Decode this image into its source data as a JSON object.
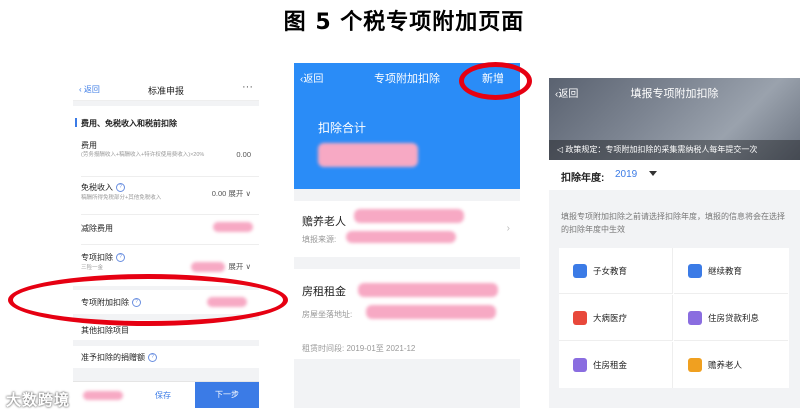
{
  "figure_title": "图 5  个税专项附加页面",
  "panel1": {
    "back": "返回",
    "title": "标准申报",
    "more": "···",
    "section": "费用、免税收入和税前扣除",
    "fee_label": "费用",
    "fee_desc": "(劳务报酬收入+稿酬收入+特许权使用费收入)×20%",
    "fee_value": "0.00",
    "exempt_label": "免税收入",
    "exempt_desc": "稿酬所得免税部分+其他免税收入",
    "exempt_value": "0.00",
    "expand": "展开",
    "deduct_fee_label": "减除费用",
    "special_label": "专项扣除",
    "special_sub": "三险一金",
    "special_add_label": "专项附加扣除",
    "other_label": "其他扣除项目",
    "donation_label": "准予扣除的捐赠额",
    "save": "保存",
    "next": "下一步"
  },
  "panel2": {
    "back": "返回",
    "title": "专项附加扣除",
    "add": "新增",
    "total": "扣除合计",
    "items": [
      {
        "name": "赡养老人",
        "meta": "填报来源:"
      },
      {
        "name": "房租租金",
        "meta": "房屋坐落地址:",
        "meta2": "租赁时间段: 2019-01至 2021-12"
      }
    ]
  },
  "panel3": {
    "back": "返回",
    "title": "填报专项附加扣除",
    "notice": "政策规定：专项附加扣除的采集需纳税人每年提交一次",
    "year_label": "扣除年度:",
    "year_value": "2019",
    "tip": "填报专项附加扣除之前请选择扣除年度，填报的信息将会在选择的扣除年度中生效",
    "categories": [
      {
        "label": "子女教育",
        "icon": "books-icon",
        "color": "#3b7be6"
      },
      {
        "label": "继续教育",
        "icon": "graduation-cap-icon",
        "color": "#3b7be6"
      },
      {
        "label": "大病医疗",
        "icon": "medical-kit-icon",
        "color": "#e8483b"
      },
      {
        "label": "住房贷款利息",
        "icon": "house-loan-icon",
        "color": "#8a6de0"
      },
      {
        "label": "住房租金",
        "icon": "house-rent-icon",
        "color": "#8a6de0"
      },
      {
        "label": "赡养老人",
        "icon": "elderly-icon",
        "color": "#f0a020"
      }
    ]
  },
  "watermark": "大数跨境"
}
